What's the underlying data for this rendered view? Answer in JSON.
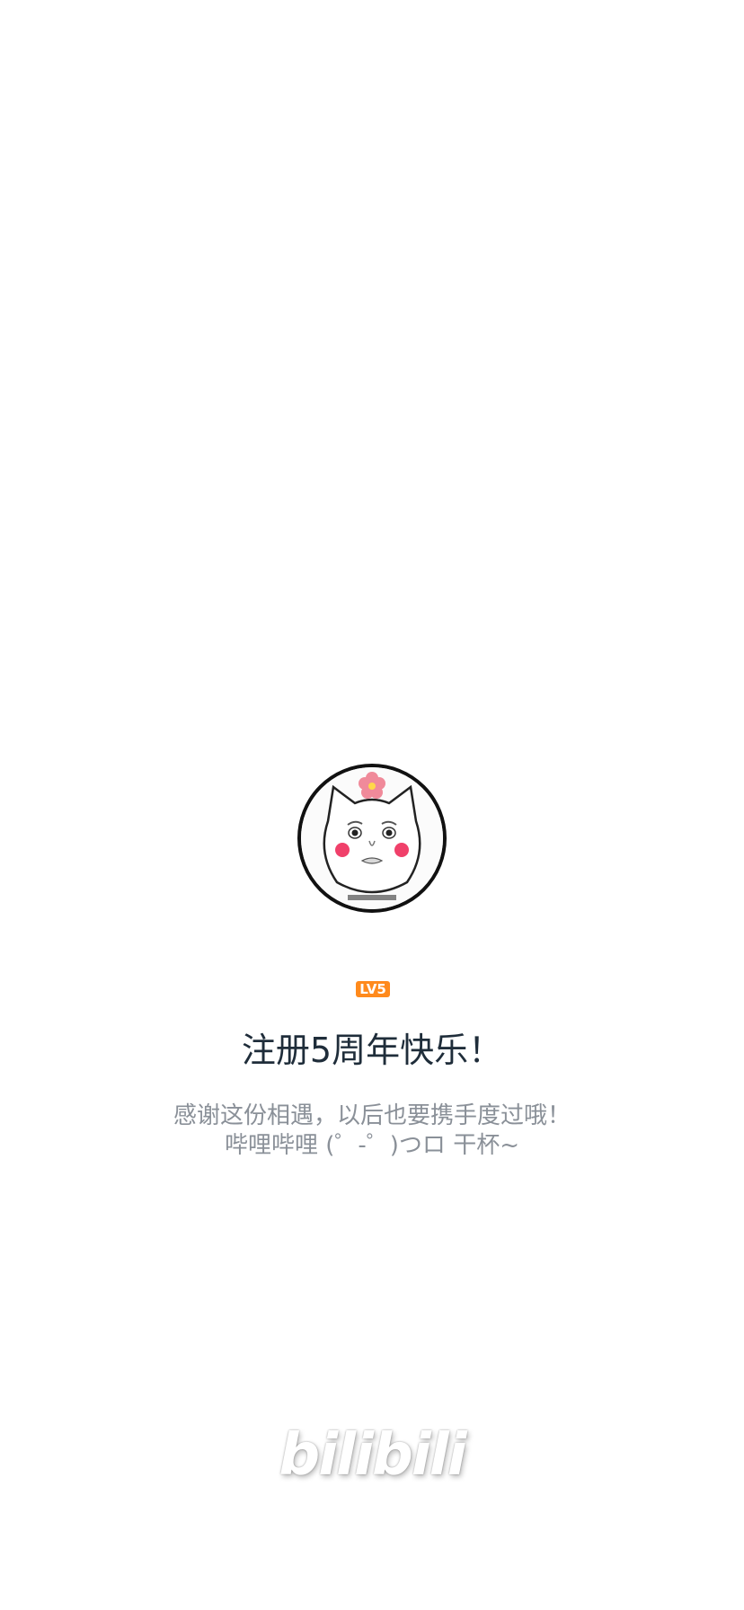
{
  "avatar": {
    "icon": "cat-face-sticker",
    "border_color": "#111111"
  },
  "level_badge": {
    "text": "LV5",
    "color": "#ff8a1c"
  },
  "title": "注册5周年快乐！",
  "subtitle": {
    "line1": "感谢这份相遇，以后也要携手度过哦！",
    "line2": "哔哩哔哩 (゜-゜)つロ 干杯~"
  },
  "brand": {
    "logo_text": "bilibili"
  },
  "colors": {
    "title": "#1f2d3a",
    "subtitle": "#8a9098",
    "background": "#ffffff"
  }
}
